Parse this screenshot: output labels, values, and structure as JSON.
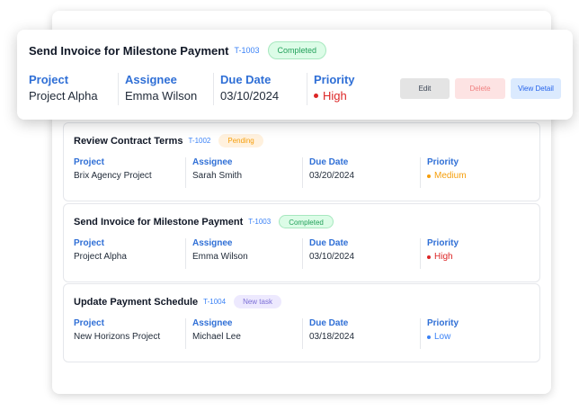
{
  "colors": {
    "accent": "#2f6fd6",
    "high": "#dc2626",
    "medium": "#f59e0b",
    "low": "#3b82f6"
  },
  "focused_task": {
    "title": "Send Invoice for Milestone Payment",
    "id": "T-1003",
    "status": "Completed",
    "project_label": "Project",
    "project": "Project Alpha",
    "assignee_label": "Assignee",
    "assignee": "Emma Wilson",
    "due_label": "Due Date",
    "due": "03/10/2024",
    "priority_label": "Priority",
    "priority": "High",
    "buttons": {
      "edit": "Edit",
      "delete": "Delete",
      "view": "View Detail"
    }
  },
  "tasks": [
    {
      "title": "Review Contract Terms",
      "id": "T-1002",
      "status": "Pending",
      "project_label": "Project",
      "project": "Brix Agency Project",
      "assignee_label": "Assignee",
      "assignee": "Sarah Smith",
      "due_label": "Due Date",
      "due": "03/20/2024",
      "priority_label": "Priority",
      "priority": "Medium"
    },
    {
      "title": "Send Invoice for Milestone Payment",
      "id": "T-1003",
      "status": "Completed",
      "project_label": "Project",
      "project": "Project Alpha",
      "assignee_label": "Assignee",
      "assignee": "Emma Wilson",
      "due_label": "Due Date",
      "due": "03/10/2024",
      "priority_label": "Priority",
      "priority": "High"
    },
    {
      "title": "Update Payment Schedule",
      "id": "T-1004",
      "status": "New task",
      "project_label": "Project",
      "project": "New Horizons Project",
      "assignee_label": "Assignee",
      "assignee": "Michael Lee",
      "due_label": "Due Date",
      "due": "03/18/2024",
      "priority_label": "Priority",
      "priority": "Low"
    }
  ]
}
